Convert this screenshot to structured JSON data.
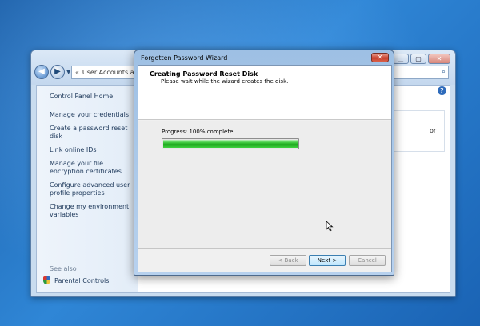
{
  "control_panel": {
    "address_chevron": "«",
    "address_text": "User Accounts a",
    "sidebar": {
      "home": "Control Panel Home",
      "links": [
        "Manage your credentials",
        "Create a password reset disk",
        "Link online IDs",
        "Manage your file encryption certificates",
        "Configure advanced user profile properties",
        "Change my environment variables"
      ],
      "see_also": "See also",
      "parental_controls": "Parental Controls"
    },
    "partial_text": "or",
    "help_glyph": "?",
    "search_glyph": "⌕"
  },
  "wizard": {
    "title": "Forgotten Password Wizard",
    "heading": "Creating Password Reset Disk",
    "subheading": "Please wait while the wizard creates the disk.",
    "progress_label": "Progress: 100% complete",
    "progress_fraction": 1.0,
    "close_glyph": "✕",
    "buttons": {
      "back": "< Back",
      "next": "Next >",
      "cancel": "Cancel"
    }
  },
  "colors": {
    "progress_green": "#1ea51e",
    "close_red": "#c7402c"
  }
}
